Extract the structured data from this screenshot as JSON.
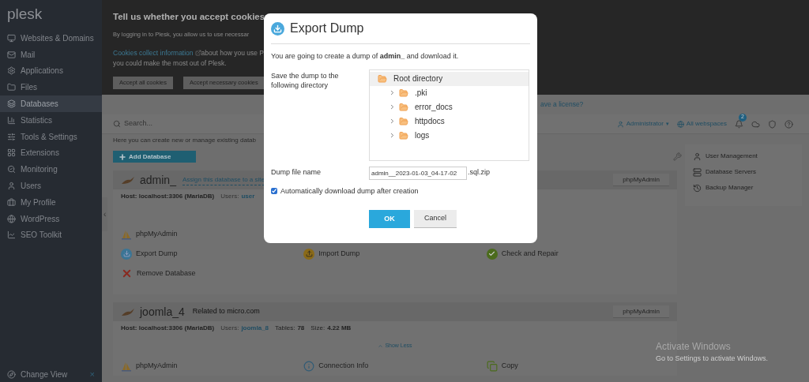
{
  "sidebar": {
    "logo": "plesk",
    "items": [
      {
        "label": "Websites & Domains",
        "selected": false
      },
      {
        "label": "Mail",
        "selected": false
      },
      {
        "label": "Applications",
        "selected": false
      },
      {
        "label": "Files",
        "selected": false
      },
      {
        "label": "Databases",
        "selected": true
      },
      {
        "label": "Statistics",
        "selected": false
      },
      {
        "label": "Tools & Settings",
        "selected": false
      },
      {
        "label": "Extensions",
        "selected": false
      },
      {
        "label": "Monitoring",
        "selected": false
      },
      {
        "label": "Users",
        "selected": false
      },
      {
        "label": "My Profile",
        "selected": false
      },
      {
        "label": "WordPress",
        "selected": false
      },
      {
        "label": "SEO Toolkit",
        "selected": false
      }
    ],
    "footer": {
      "label": "Change View",
      "close": "×"
    },
    "collapse": "‹"
  },
  "cookie_banner": {
    "title": "Tell us whether you accept cookies",
    "text": "By logging in to Plesk, you allow us to use necessar",
    "link": "Cookies collect information",
    "text_2": " about how you use P",
    "text_3": "you could make the most out of Plesk.",
    "buttons": [
      "Accept all cookies",
      "Accept necessary cookies"
    ]
  },
  "license_link": "ave a license?",
  "header": {
    "search_placeholder": "Search...",
    "user": "Administrator",
    "user_caret": "▾",
    "webspaces": "All webspaces",
    "notifications": "2"
  },
  "intro": "Here you can create new or manage existing datab",
  "add_button": "Add Database",
  "databases": [
    {
      "name": "admin_",
      "assign_link": "Assign this database to a site",
      "header_button": "phpMyAdmin",
      "host": "Host: localhost:3306 (MariaDB)",
      "users_label": "Users:",
      "users": "user",
      "action_rows": [
        [
          {
            "label": "phpMyAdmin",
            "kind": "phpmyadmin"
          }
        ],
        [
          {
            "label": "Export Dump",
            "kind": "export"
          },
          {
            "label": "Import Dump",
            "kind": "import"
          },
          {
            "label": "Check and Repair",
            "kind": "check"
          }
        ],
        [
          {
            "label": "Remove Database",
            "kind": "remove"
          }
        ]
      ]
    },
    {
      "name": "joomla_4",
      "related": "Related to micro.com",
      "header_button": "phpMyAdmin",
      "host": "Host: localhost:3306 (MariaDB)",
      "users_label": "Users:",
      "users": "joomla_8",
      "tables_label": "Tables:",
      "tables": "78",
      "size_label": "Size:",
      "size": "4.22 MB",
      "show_less": "Show Less",
      "action_rows": [
        [
          {
            "label": "phpMyAdmin",
            "kind": "phpmyadmin"
          },
          {
            "label": "Connection Info",
            "kind": "info"
          },
          {
            "label": "Copy",
            "kind": "copy"
          }
        ]
      ]
    }
  ],
  "side_panel": [
    {
      "label": "User Management",
      "kind": "users"
    },
    {
      "label": "Database Servers",
      "kind": "servers"
    },
    {
      "label": "Backup Manager",
      "kind": "backup"
    }
  ],
  "dialog": {
    "title": "Export Dump",
    "intro": "You are going to create a dump of **admin_** and download it.",
    "directory_label": "Save the dump to the following directory",
    "tree": {
      "label": "Root directory",
      "selected": true,
      "children": [
        {
          "label": ".pki",
          "selected": false,
          "expanded": false
        },
        {
          "label": "error_docs",
          "selected": false,
          "expanded": false
        },
        {
          "label": "httpdocs",
          "selected": false,
          "expanded": false
        },
        {
          "label": "logs",
          "selected": false,
          "expanded": false
        }
      ]
    },
    "file_label": "Dump file name",
    "file_value": "admin__2023-01-03_04-17-02",
    "file_suffix": ".sql.zip",
    "auto_download": {
      "label": "Automatically download dump after creation",
      "checked": true
    },
    "ok": "OK",
    "cancel": "Cancel"
  },
  "os_notice": {
    "title": "Activate Windows",
    "text": "Go to Settings to activate Windows."
  }
}
